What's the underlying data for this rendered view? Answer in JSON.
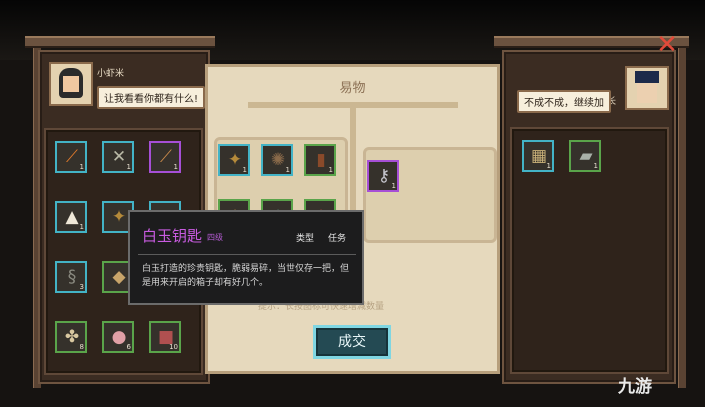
{
  "left_npc": {
    "name": "小虾米",
    "speech": "让我看看你都有什么!"
  },
  "right_npc": {
    "name": "村长",
    "speech": "不成不成，继续加"
  },
  "center": {
    "title": "易物",
    "hint": "提示：长按图标可快速增减数量",
    "trade_button": "成交"
  },
  "left_inventory": [
    {
      "icon": "fire-spear-icon",
      "glyph": "⟋",
      "color": "#e07a2a",
      "border": "blue",
      "qty": "1"
    },
    {
      "icon": "halberd-icon",
      "glyph": "✕",
      "color": "#b9b9a6",
      "border": "blue",
      "qty": "1"
    },
    {
      "icon": "staff-icon",
      "glyph": "⟋",
      "color": "#c98a4a",
      "border": "purple",
      "qty": "1"
    },
    {
      "icon": "powder-pile-icon",
      "glyph": "▲",
      "color": "#efe8d8",
      "border": "blue",
      "qty": "1"
    },
    {
      "icon": "scorpion-icon",
      "glyph": "✦",
      "color": "#b58a3a",
      "border": "blue",
      "qty": ""
    },
    {
      "icon": "item-icon",
      "glyph": "◆",
      "color": "#9a7a5a",
      "border": "blue",
      "qty": ""
    },
    {
      "icon": "bead-chain-icon",
      "glyph": "§",
      "color": "#8a8a80",
      "border": "blue",
      "qty": "3"
    },
    {
      "icon": "scroll-icon",
      "glyph": "◆",
      "color": "#c8a46a",
      "border": "green",
      "qty": ""
    },
    {
      "icon": "item-icon",
      "glyph": "◆",
      "color": "#9a7a5a",
      "border": "blue",
      "qty": ""
    },
    {
      "icon": "bones-icon",
      "glyph": "✤",
      "color": "#d8c7a0",
      "border": "green",
      "qty": "8"
    },
    {
      "icon": "meat-icon",
      "glyph": "●",
      "color": "#e0a0a6",
      "border": "green",
      "qty": "6"
    },
    {
      "icon": "red-ore-icon",
      "glyph": "■",
      "color": "#b05050",
      "border": "green",
      "qty": "10"
    }
  ],
  "offer_left": [
    {
      "icon": "scorpion-icon",
      "glyph": "✦",
      "color": "#b58a3a",
      "border": "blue",
      "qty": "1"
    },
    {
      "icon": "spider-icon",
      "glyph": "✺",
      "color": "#8a6a4a",
      "border": "blue",
      "qty": "1"
    },
    {
      "icon": "leather-armor-icon",
      "glyph": "▮",
      "color": "#8a4a2a",
      "border": "green",
      "qty": "1"
    },
    {
      "icon": "item-icon",
      "glyph": "◆",
      "color": "#8a6a3a",
      "border": "green",
      "qty": ""
    },
    {
      "icon": "item-icon",
      "glyph": "◆",
      "color": "#4a6a5a",
      "border": "green",
      "qty": ""
    },
    {
      "icon": "item-icon",
      "glyph": "◆",
      "color": "#8a3a3a",
      "border": "green",
      "qty": ""
    }
  ],
  "offer_right": [
    {
      "icon": "key-icon",
      "glyph": "⚷",
      "color": "#c8c8d0",
      "border": "purple",
      "qty": "1"
    }
  ],
  "right_inventory": [
    {
      "icon": "map-scroll-icon",
      "glyph": "▦",
      "color": "#c8b078",
      "border": "blue",
      "qty": "1"
    },
    {
      "icon": "silver-ingot-icon",
      "glyph": "▰",
      "color": "#a8b0a8",
      "border": "green",
      "qty": "1"
    }
  ],
  "tooltip": {
    "name": "白玉钥匙",
    "grade": "四级",
    "type_label": "类型",
    "type_value": "任务",
    "description": "白玉打造的珍贵钥匙，脆弱易碎，当世仅存一把，但是用来开启的箱子却有好几个。"
  },
  "close_icon": "close-icon",
  "watermark": "九游"
}
